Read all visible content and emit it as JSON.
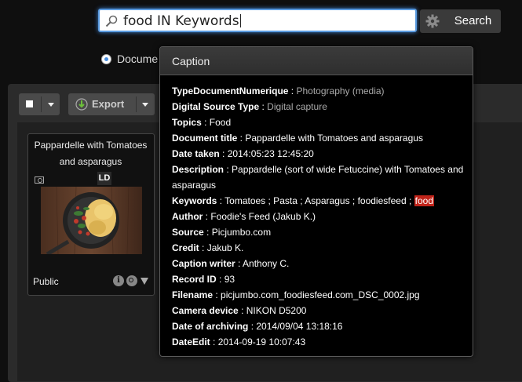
{
  "search": {
    "query": "food IN Keywords",
    "button_label": "Search"
  },
  "scope": {
    "radio_label": "Docume"
  },
  "toolbar": {
    "export_label": "Export"
  },
  "card": {
    "title": "Pappardelle with Tomatoes and asparagus",
    "badge": "LD",
    "visibility": "Public",
    "info_glyph": "i"
  },
  "popup": {
    "title": "Caption",
    "fields": [
      {
        "key": "TypeDocumentNumerique",
        "value": "Photography (media)",
        "gray": true
      },
      {
        "key": "Digital Source Type",
        "value": "Digital capture",
        "gray": true
      },
      {
        "key": "Topics",
        "value": "Food"
      },
      {
        "key": "Document title",
        "value": "Pappardelle with Tomatoes and asparagus"
      },
      {
        "key": "Date taken",
        "value": "2014:05:23 12:45:20"
      },
      {
        "key": "Description",
        "value": "Pappardelle (sort of wide Fetuccine) with Tomatoes and asparagus"
      },
      {
        "key": "Keywords",
        "value": "Tomatoes ; Pasta ; Asparagus ; foodiesfeed ;",
        "highlight": "food"
      },
      {
        "key": "Author",
        "value": "Foodie's Feed (Jakub K.)"
      },
      {
        "key": "Source",
        "value": "Picjumbo.com"
      },
      {
        "key": "Credit",
        "value": "Jakub K."
      },
      {
        "key": "Caption writer",
        "value": "Anthony C."
      },
      {
        "key": "Record ID",
        "value": "93"
      },
      {
        "key": "Filename",
        "value": "picjumbo.com_foodiesfeed.com_DSC_0002.jpg"
      },
      {
        "key": "Camera device",
        "value": "NIKON D5200"
      },
      {
        "key": "Date of archiving",
        "value": "2014/09/04 13:18:16"
      },
      {
        "key": "DateEdit",
        "value": "2014-09-19 10:07:43"
      }
    ]
  },
  "colors": {
    "focus_ring": "#5a9be0",
    "highlight": "#c0241a",
    "radio_selected": "#4a8fe0"
  },
  "icons": [
    "search-icon",
    "gear-icon",
    "export-icon",
    "camera-icon",
    "info-icon",
    "zoom-icon",
    "chevron-down-icon"
  ]
}
